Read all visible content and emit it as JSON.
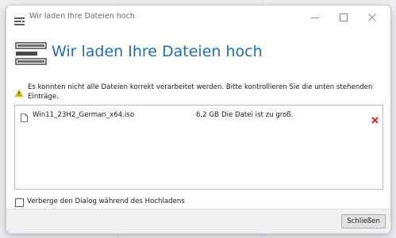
{
  "window": {
    "title": "Wir laden Ihre Dateien hoch"
  },
  "header": {
    "title": "Wir laden Ihre Dateien hoch"
  },
  "warning": {
    "text": "Es konnten nicht alle Dateien korrekt verarbeitet werden. Bitte kontrollieren Sie die unten stehenden Einträge."
  },
  "files": [
    {
      "name": "Win11_23H2_German_x64.iso",
      "size": "6,2 GB",
      "status": "Die Datei ist zu groß."
    }
  ],
  "options": {
    "hide_dialog_label": "Verberge den Dialog während des Hochladens",
    "hide_dialog_checked": false
  },
  "footer": {
    "close_label": "Schließen"
  },
  "colors": {
    "accent": "#1f6fb8",
    "warning": "#f2c500",
    "error": "#d32f2f"
  },
  "icons": {
    "app": "upload-list-icon",
    "header": "upload-list-icon",
    "warning": "warning-triangle-icon",
    "file": "document-icon",
    "remove": "red-x-icon"
  }
}
